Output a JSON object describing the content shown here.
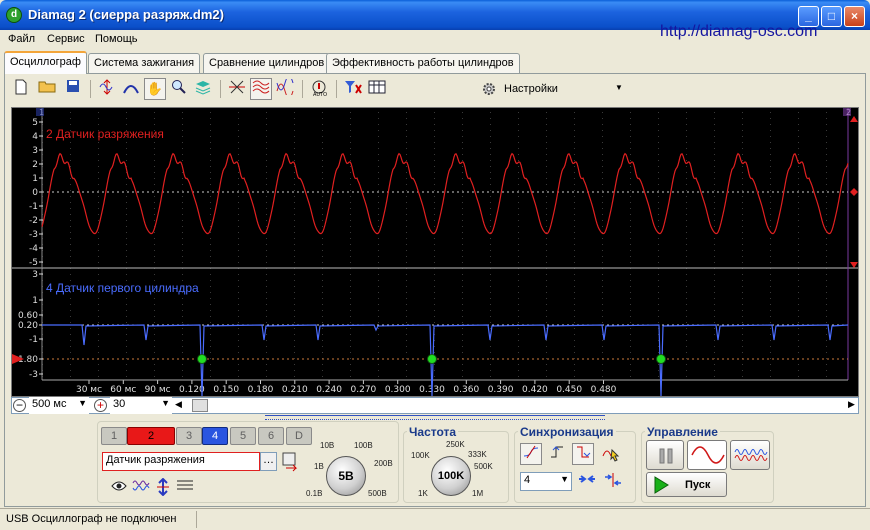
{
  "window": {
    "title": "Diamag 2 (сиерра разряж.dm2)",
    "icon": "app-icon"
  },
  "menu": [
    "Файл",
    "Сервис",
    "Помощь"
  ],
  "site_link": "http://diamag-osc.com",
  "tabs": [
    "Осциллограф",
    "Система зажигания",
    "Сравнение цилиндров",
    "Эффективность работы цилиндров"
  ],
  "toolbar": {
    "settings_label": "Настройки"
  },
  "channel1": {
    "label": "2 Датчик разряжения",
    "color": "#e02020",
    "y_ticks": [
      "5",
      "4",
      "3",
      "2",
      "1",
      "0",
      "-1",
      "-2",
      "-3",
      "-4",
      "-5"
    ]
  },
  "channel2": {
    "label": "4 Датчик первого цилиндра",
    "color": "#4a6cff",
    "y_ticks": [
      "3",
      "1",
      "0.60",
      "0.20",
      "0",
      "-1",
      "-1.80",
      "-3"
    ]
  },
  "x_ticks": [
    "30 мс",
    "60 мс",
    "90 мс",
    "0.120",
    "0.150",
    "0.180",
    "0.210",
    "0.240",
    "0.270",
    "0.300",
    "0.330",
    "0.360",
    "0.390",
    "0.420",
    "0.450",
    "0.480"
  ],
  "marker_labels": [
    "1",
    "2"
  ],
  "timebase": "500 мс",
  "offset_value": "30",
  "channel_buttons": [
    "1",
    "2",
    "3",
    "4",
    "5",
    "6",
    "D"
  ],
  "sensor_select": "Датчик разряжения",
  "volt_knob": {
    "value": "5В",
    "labels": [
      "10В",
      "100В",
      "200В",
      "500В",
      "0.1В",
      "1В"
    ]
  },
  "freq": {
    "title": "Частота",
    "value": "100K",
    "labels": [
      "250K",
      "333K",
      "500K",
      "1M",
      "1K",
      "100K"
    ]
  },
  "sync": {
    "title": "Синхронизация",
    "value": "4"
  },
  "control": {
    "title": "Управление",
    "start_label": "Пуск"
  },
  "status": "USB Осциллограф не подключен"
}
